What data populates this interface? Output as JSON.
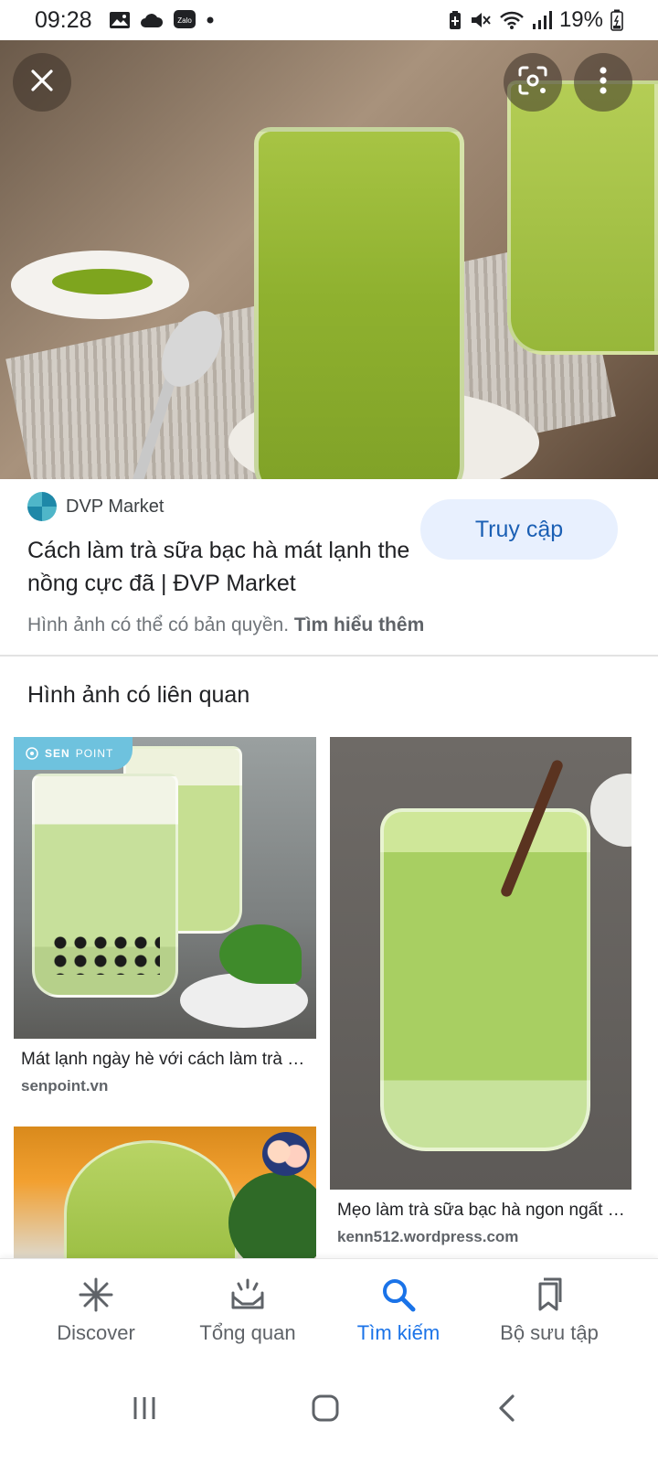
{
  "status_bar": {
    "time": "09:28",
    "left_icons": [
      "gallery-icon",
      "cloud-icon",
      "zalo-icon",
      "dot-icon"
    ],
    "zalo_label": "Zalo",
    "battery": "19%",
    "right_icons": [
      "battery-saver-icon",
      "mute-icon",
      "wifi-icon",
      "signal-icon",
      "battery-icon"
    ]
  },
  "viewer": {
    "close_icon": "close-icon",
    "lens_icon": "google-lens-icon",
    "more_icon": "more-vert-icon"
  },
  "result": {
    "site_name": "DVP Market",
    "title": "Cách làm trà sữa bạc hà mát lạnh the nồng cực đã | ĐVP Market",
    "visit_button": "Truy cập",
    "copyright_text": "Hình ảnh có thể có bản quyền.",
    "learn_more": "Tìm hiểu thêm"
  },
  "related": {
    "heading": "Hình ảnh có liên quan",
    "items": [
      {
        "title": "Mát lạnh ngày hè với cách làm trà sữa bạc hà",
        "domain": "senpoint.vn",
        "badge_strong": "SEN",
        "badge_rest": "POINT"
      },
      {
        "title": "Mẹo làm trà sữa bạc hà ngon ngất ngây",
        "domain": "kenn512.wordpress.com"
      },
      {
        "title": "",
        "domain": ""
      }
    ]
  },
  "bottom_nav": {
    "items": [
      {
        "label": "Discover",
        "icon": "asterisk-icon"
      },
      {
        "label": "Tổng quan",
        "icon": "updates-icon"
      },
      {
        "label": "Tìm kiếm",
        "icon": "search-icon"
      },
      {
        "label": "Bộ sưu tập",
        "icon": "bookmarks-icon"
      }
    ],
    "active_index": 2,
    "active_color": "#1a73e8",
    "inactive_color": "#5f6368"
  },
  "system_nav": {
    "icons": [
      "recents-icon",
      "home-icon",
      "back-icon"
    ]
  }
}
